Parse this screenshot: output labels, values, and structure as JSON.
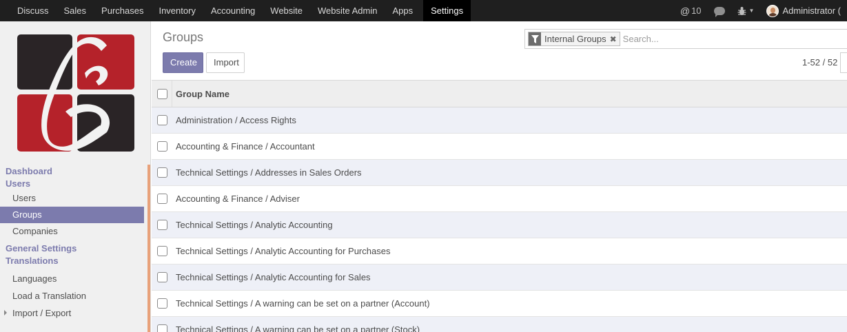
{
  "topnav": {
    "menu": [
      "Discuss",
      "Sales",
      "Purchases",
      "Inventory",
      "Accounting",
      "Website",
      "Website Admin",
      "Apps"
    ],
    "active": "Settings",
    "mentions_count": "10",
    "user_name": "Administrator (",
    "icons": [
      "at-icon",
      "chat-icon",
      "bug-icon",
      "avatar"
    ]
  },
  "sidebar": {
    "sections": [
      {
        "label": "Dashboard"
      },
      {
        "label": "Users",
        "items": [
          "Users",
          "Groups",
          "Companies"
        ]
      },
      {
        "label": "General Settings"
      },
      {
        "label": "Translations",
        "items": [
          "Languages",
          "Load a Translation",
          "Import / Export"
        ]
      }
    ],
    "active_item": "Groups"
  },
  "main": {
    "title": "Groups",
    "create_label": "Create",
    "import_label": "Import",
    "pager": "1-52 / 52",
    "search": {
      "facet_label": "Internal Groups",
      "facet_remove": "✖",
      "placeholder": "Search..."
    },
    "table": {
      "column": "Group Name",
      "rows": [
        "Administration / Access Rights",
        "Accounting & Finance / Accountant",
        "Technical Settings / Addresses in Sales Orders",
        "Accounting & Finance / Adviser",
        "Technical Settings / Analytic Accounting",
        "Technical Settings / Analytic Accounting for Purchases",
        "Technical Settings / Analytic Accounting for Sales",
        "Technical Settings / A warning can be set on a partner (Account)",
        "Technical Settings / A warning can be set on a partner (Stock)"
      ]
    }
  },
  "colors": {
    "topbar": "#1f1f1f",
    "accent": "#7c7bad",
    "logo_red": "#b5222a",
    "logo_dark": "#2a2426"
  }
}
